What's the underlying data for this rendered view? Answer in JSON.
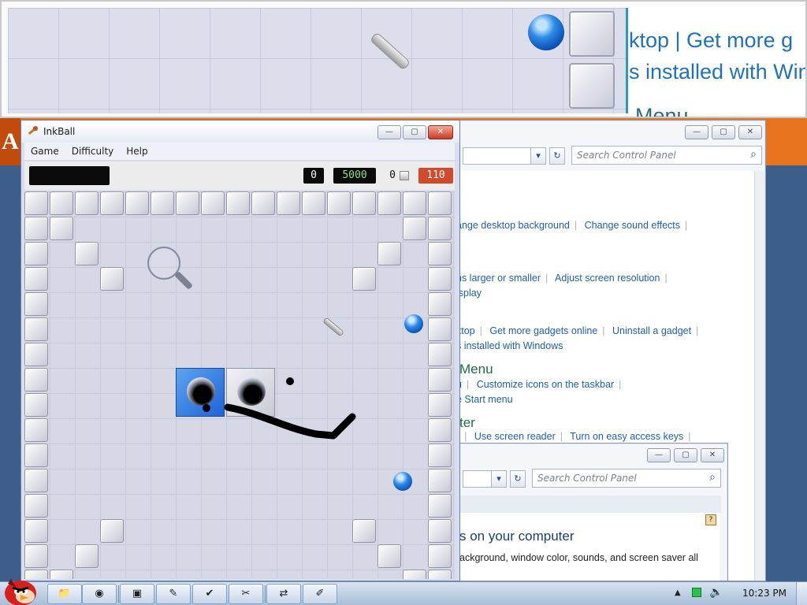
{
  "magnifier": {
    "line1": "ktop   |   Get more g",
    "line2": "s installed with Win",
    "line3": "Menu"
  },
  "orange_app": {
    "letter": "A"
  },
  "cp_main": {
    "search_placeholder": "Search Control Panel",
    "rows": [
      [
        "ange desktop background",
        "Change sound effects"
      ],
      [
        "ns larger or smaller",
        "Adjust screen resolution"
      ],
      [
        "isplay"
      ],
      [
        "ktop",
        "Get more gadgets online",
        "Uninstall a gadget"
      ],
      [
        "s installed with Windows"
      ]
    ],
    "heading_menu": "Menu",
    "menu_rows": [
      [
        "u",
        "Customize icons on the taskbar"
      ],
      [
        "e Start menu"
      ]
    ],
    "heading_center": "ter",
    "center_row": [
      "r",
      "Use screen reader",
      "Turn on easy access keys"
    ]
  },
  "cp_second": {
    "search_placeholder": "Search Control Panel",
    "heading": "s on your computer",
    "text": "ackground, window color, sounds, and screen saver all"
  },
  "inkball": {
    "title": "InkBall",
    "menu": [
      "Game",
      "Difficulty",
      "Help"
    ],
    "score_a": "0",
    "score_b": "5000",
    "score_c": "0",
    "score_d": "110"
  },
  "taskbar": {
    "clock": "10:23 PM",
    "icons": [
      "angry-birds-icon",
      "explorer-icon",
      "chrome-icon",
      "cmd-icon",
      "notepad-icon",
      "security-icon",
      "paint-icon",
      "remote-desktop-icon",
      "inkball-icon"
    ]
  },
  "colors": {
    "ball_blue": "#1f6fd4",
    "score_red": "#d24a2e",
    "score_green": "#8ee27a",
    "link_blue": "#1e5fb0",
    "heading_green": "#1f6b44",
    "taskbar": "#b8cbe2",
    "orange": "#e8731e"
  }
}
